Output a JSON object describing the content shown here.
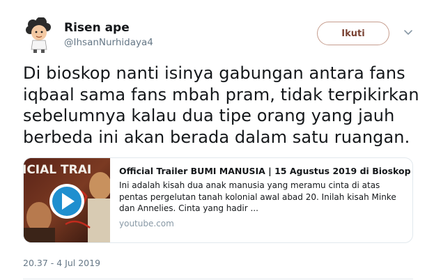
{
  "author": {
    "display_name": "Risen ape",
    "handle": "@IhsanNurhidaya4"
  },
  "follow_button": {
    "label": "Ikuti"
  },
  "tweet": {
    "text": "Di bioskop nanti isinya gabungan antara fans iqbaal sama fans mbah pram, tidak terpikirkan sebelumnya kalau dua tipe orang yang jauh berbeda ini akan berada dalam satu ruangan.",
    "timestamp": "20.37 - 4 Jul 2019"
  },
  "link_card": {
    "title": "Official Trailer BUMI MANUSIA | 15 Agustus 2019 di Bioskop",
    "description": "Ini adalah kisah dua anak manusia yang meramu cinta di atas pentas pergelutan tanah kolonial awal abad 20. Inilah kisah Minke dan Annelies. Cinta yang hadir ...",
    "domain": "youtube.com",
    "thumbnail_text": "ICIAL TRAI"
  },
  "colors": {
    "follow_border": "#c69d8e",
    "follow_text": "#7a4334",
    "muted": "#657786",
    "play_button": "#1f8fcf"
  },
  "icons": {
    "menu": "chevron-down-icon",
    "play": "play-icon"
  }
}
